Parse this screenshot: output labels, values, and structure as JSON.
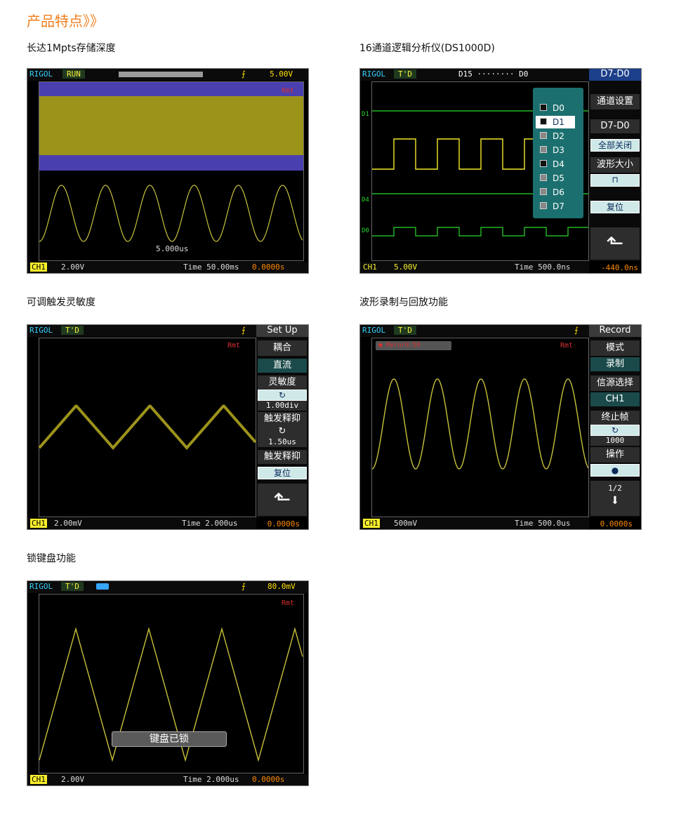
{
  "heading": "产品特点》》",
  "captions": {
    "p1": "长达1Mpts存储深度",
    "p2": "16通道逻辑分析仪(DS1000D)",
    "p3": "可调触发灵敏度",
    "p4": "波形录制与回放功能",
    "p5": "锁键盘功能"
  },
  "scope1": {
    "brand": "RIGOL",
    "status": "RUN",
    "trig_level": "5.00V",
    "rmt": "Rmt",
    "timebase_label": "5.000us",
    "ch": "CH1",
    "volts": "2.00V",
    "time": "Time 50.00ms",
    "toffset": "0.0000s"
  },
  "scope2": {
    "brand": "RIGOL",
    "status": "T'D",
    "digital_range": "D15 ········ D0",
    "ch": "CH1",
    "volts": "5.00V",
    "time": "Time 500.0ns",
    "toffset": "-440.0ns",
    "labels": [
      "D1",
      "D4",
      "D0"
    ],
    "popup": [
      "D0",
      "D1",
      "D2",
      "D3",
      "D4",
      "D5",
      "D6",
      "D7"
    ],
    "menu": {
      "head": "D7-D0",
      "item1": "通道设置",
      "item2": "D7-D0",
      "val2": "全部关闭",
      "item3": "波形大小",
      "val4": "复位"
    }
  },
  "scope3": {
    "brand": "RIGOL",
    "status": "T'D",
    "rmt": "Rmt",
    "ch": "CH1",
    "volts": "2.00mV",
    "time": "Time 2.000us",
    "toffset": "0.0000s",
    "menu": {
      "head": "Set Up",
      "item1": "耦合",
      "val1": "直流",
      "item2": "灵敏度",
      "val2": "1.00div",
      "item3": "触发释抑",
      "val3": "1.50us",
      "item4": "触发释抑",
      "val4": "复位"
    }
  },
  "scope4": {
    "brand": "RIGOL",
    "status": "T'D",
    "rmt": "Rmt",
    "recording": "Record:50",
    "ch": "CH1",
    "volts": "500mV",
    "time": "Time 500.0us",
    "toffset": "0.0000s",
    "menu": {
      "head": "Record",
      "item1": "模式",
      "val1": "录制",
      "item2": "信源选择",
      "val2": "CH1",
      "item3": "终止帧",
      "val3": "1000",
      "item4": "操作",
      "page": "1/2"
    }
  },
  "scope5": {
    "brand": "RIGOL",
    "status": "T'D",
    "trig_level": "80.0mV",
    "rmt": "Rmt",
    "locked": "键盘已锁",
    "ch": "CH1",
    "volts": "2.00V",
    "time": "Time 2.000us",
    "toffset": "0.0000s"
  }
}
